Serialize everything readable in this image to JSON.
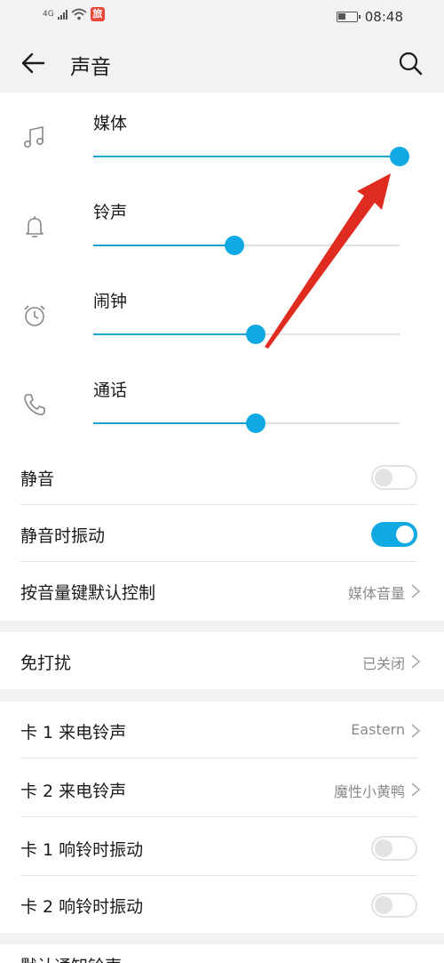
{
  "status_bar": {
    "network": "4G",
    "time": "08:48",
    "battery_level": 0.45,
    "app_icon_glyph": "旅"
  },
  "header": {
    "title": "声音"
  },
  "volumes": [
    {
      "label": "媒体",
      "icon": "music-note-icon",
      "level": 1.0
    },
    {
      "label": "铃声",
      "icon": "bell-icon",
      "level": 0.46
    },
    {
      "label": "闹钟",
      "icon": "alarm-clock-icon",
      "level": 0.53
    },
    {
      "label": "通话",
      "icon": "phone-icon",
      "level": 0.53
    }
  ],
  "settings": {
    "mute": {
      "label": "静音",
      "on": false
    },
    "vibrate_on_mute": {
      "label": "静音时振动",
      "on": true
    },
    "volume_key": {
      "label": "按音量键默认控制",
      "value": "媒体音量"
    },
    "dnd": {
      "label": "免打扰",
      "value": "已关闭"
    },
    "sim1_ringtone": {
      "label": "卡 1 来电铃声",
      "value": "Eastern"
    },
    "sim2_ringtone": {
      "label": "卡 2 来电铃声",
      "value": "魔性小黄鸭"
    },
    "sim1_vibrate": {
      "label": "卡 1 响铃时振动",
      "on": false
    },
    "sim2_vibrate": {
      "label": "卡 2 响铃时振动",
      "on": false
    },
    "default_notification": {
      "label": "默认通知铃声"
    }
  },
  "colors": {
    "accent": "#12a9e3",
    "annotation_arrow": "#e02b20"
  }
}
